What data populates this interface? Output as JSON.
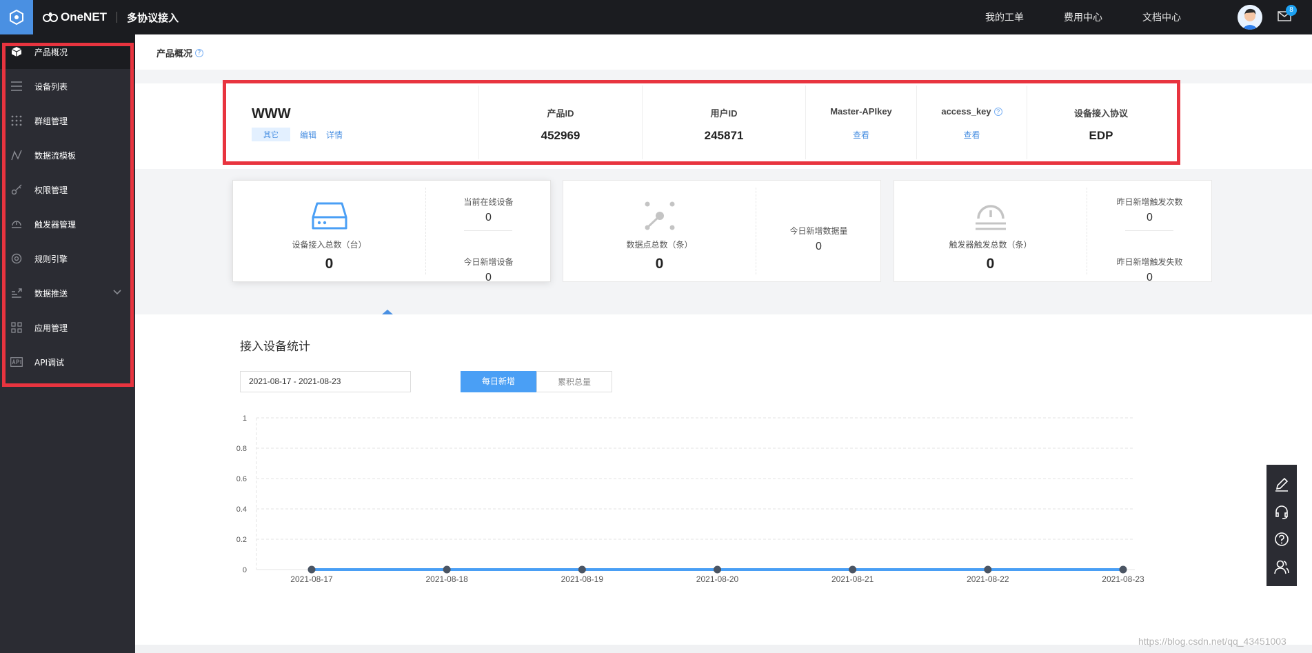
{
  "app": {
    "brand": "OneNET",
    "section": "多协议接入"
  },
  "top_nav": {
    "links": [
      "我的工单",
      "费用中心",
      "文档中心"
    ],
    "mail_count": "8"
  },
  "sidebar": {
    "items": [
      {
        "label": "产品概况",
        "icon": "cube-icon",
        "active": true
      },
      {
        "label": "设备列表",
        "icon": "list-icon"
      },
      {
        "label": "群组管理",
        "icon": "grid-dots-icon"
      },
      {
        "label": "数据流模板",
        "icon": "datastream-icon"
      },
      {
        "label": "权限管理",
        "icon": "key-icon"
      },
      {
        "label": "触发器管理",
        "icon": "trigger-icon"
      },
      {
        "label": "规则引擎",
        "icon": "rule-engine-icon"
      },
      {
        "label": "数据推送",
        "icon": "push-icon",
        "expandable": true
      },
      {
        "label": "应用管理",
        "icon": "apps-icon"
      },
      {
        "label": "API调试",
        "icon": "api-icon"
      }
    ]
  },
  "page": {
    "title": "产品概况",
    "help": "?"
  },
  "product": {
    "name": "WWW",
    "category": "其它",
    "edit": "编辑",
    "detail": "详情",
    "product_id_label": "产品ID",
    "product_id": "452969",
    "user_id_label": "用户ID",
    "user_id": "245871",
    "master_apikey_label": "Master-APIkey",
    "master_apikey_action": "查看",
    "access_key_label": "access_key",
    "access_key_help": "?",
    "access_key_action": "查看",
    "protocol_label": "设备接入协议",
    "protocol": "EDP"
  },
  "cards": [
    {
      "caption": "设备接入总数（台）",
      "value": "0",
      "subs": [
        {
          "caption": "当前在线设备",
          "value": "0"
        },
        {
          "caption": "今日新增设备",
          "value": "0"
        }
      ]
    },
    {
      "caption": "数据点总数（条）",
      "value": "0",
      "subs": [
        {
          "caption": "今日新增数据量",
          "value": "0"
        }
      ]
    },
    {
      "caption": "触发器触发总数（条）",
      "value": "0",
      "subs": [
        {
          "caption": "昨日新增触发次数",
          "value": "0"
        },
        {
          "caption": "昨日新增触发失败",
          "value": "0"
        }
      ]
    }
  ],
  "stats": {
    "title": "接入设备统计",
    "date_range": "2021-08-17 - 2021-08-23",
    "btn_daily": "每日新增",
    "btn_total": "累积总量"
  },
  "chart_data": {
    "type": "line",
    "x": [
      "2021-08-17",
      "2021-08-18",
      "2021-08-19",
      "2021-08-20",
      "2021-08-21",
      "2021-08-22",
      "2021-08-23"
    ],
    "series": [
      {
        "values": [
          0,
          0,
          0,
          0,
          0,
          0,
          0
        ]
      }
    ],
    "yticks": [
      "0",
      "0.2",
      "0.4",
      "0.6",
      "0.8",
      "1"
    ],
    "ylim": [
      0,
      1
    ],
    "grid": true,
    "line_color": "#4a9ff5",
    "point_color": "#4b5563"
  },
  "watermark": "https://blog.csdn.net/qq_43451003"
}
